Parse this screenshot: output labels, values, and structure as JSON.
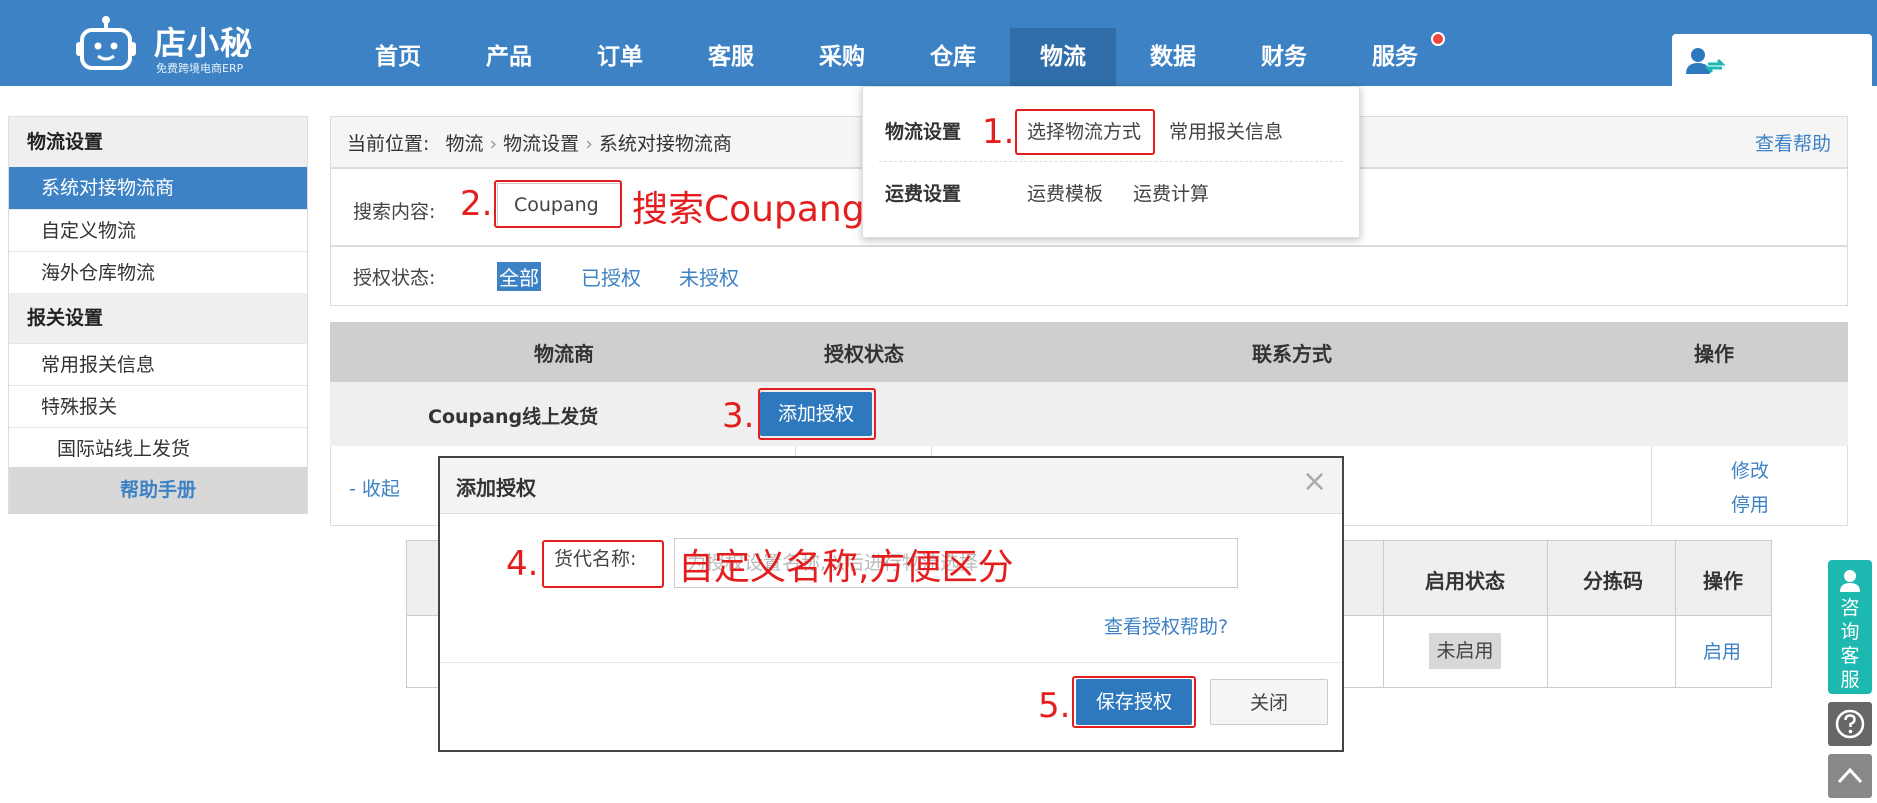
{
  "brand": {
    "name": "店小秘",
    "tagline": "免费跨境电商ERP",
    "color": "#3d82c4"
  },
  "nav": {
    "items": [
      {
        "label": "首页"
      },
      {
        "label": "产品"
      },
      {
        "label": "订单"
      },
      {
        "label": "客服"
      },
      {
        "label": "采购"
      },
      {
        "label": "仓库"
      },
      {
        "label": "物流",
        "active": true
      },
      {
        "label": "数据"
      },
      {
        "label": "财务"
      },
      {
        "label": "服务",
        "badge": "red-dot"
      }
    ],
    "user_icon": "user-switch-icon"
  },
  "sidebar": {
    "sections": [
      {
        "title": "物流设置",
        "items": [
          "系统对接物流商",
          "自定义物流",
          "海外仓库物流"
        ],
        "active_item": "系统对接物流商"
      },
      {
        "title": "报关设置",
        "items": [
          "常用报关信息",
          "特殊报关"
        ],
        "sub_items": [
          "国际站线上发货"
        ]
      }
    ],
    "help_label": "帮助手册"
  },
  "breadcrumb": {
    "prefix": "当前位置:",
    "path": [
      "物流",
      "物流设置",
      "系统对接物流商"
    ],
    "help_link": "查看帮助"
  },
  "dropdown": {
    "rows": [
      {
        "title": "物流设置",
        "links": [
          "选择物流方式",
          "常用报关信息"
        ]
      },
      {
        "title": "运费设置",
        "links": [
          "运费模板",
          "运费计算"
        ]
      }
    ]
  },
  "search": {
    "label": "搜索内容:",
    "value": "Coupang"
  },
  "auth_filter": {
    "label": "授权状态:",
    "options": [
      "全部",
      "已授权",
      "未授权"
    ],
    "selected": "全部"
  },
  "table": {
    "headers": [
      "物流商",
      "授权状态",
      "联系方式",
      "操作"
    ],
    "row": {
      "provider": "Coupang线上发货",
      "action_button": "添加授权"
    },
    "collapse_label": "- 收起",
    "row_actions": [
      "修改",
      "停用"
    ]
  },
  "inner_table": {
    "headers": [
      "启用状态",
      "分拣码",
      "操作"
    ],
    "row": {
      "status": "未启用",
      "action": "启用"
    }
  },
  "modal": {
    "title": "添加授权",
    "close_glyph": "×",
    "field_label": "货代名称:",
    "field_placeholder": "为授权设置名称,以后进行物流选择",
    "help_link": "查看授权帮助?",
    "save_button": "保存授权",
    "close_button": "关闭"
  },
  "annotations": {
    "step1": "1.",
    "step2": "2.",
    "step2_note": "搜索Coupang",
    "step3": "3.",
    "step4": "4.",
    "step4_note": "自定义名称,方便区分",
    "step5": "5.",
    "color": "#e41e1e"
  },
  "float_panel": {
    "consult_label": [
      "咨",
      "询",
      "客",
      "服"
    ]
  }
}
